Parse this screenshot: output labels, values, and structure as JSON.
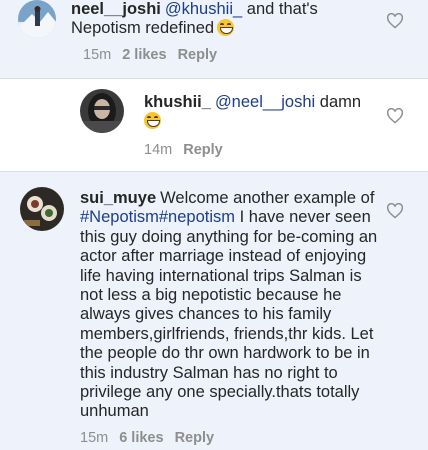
{
  "comments": [
    {
      "username": "neel__joshi",
      "mention": "@khushii_",
      "text": "and that's Nepotism redefined",
      "time": "15m",
      "likes": "2 likes",
      "reply": "Reply"
    },
    {
      "username": "khushii_",
      "mention": "@neel__joshi",
      "text": "damn",
      "time": "14m",
      "reply": "Reply"
    },
    {
      "username": "sui_muye",
      "text_before": "Welcome another example of",
      "tags": "#Nepotism#nepotism",
      "text_after": "I have never seen this guy doing anything for be-coming an actor after marriage instead of enjoying life having international trips Salman is not less a big nepotistic because he always gives chances to his family members,girlfriends, friends,thr kids. Let the people do thr own hardwork to be in this industry Salman has no right to privilege any one specially.thats totally unhuman",
      "time": "15m",
      "likes": "6 likes",
      "reply": "Reply"
    }
  ],
  "icons": {
    "like": "heart-outline-icon",
    "emoji": "grinning-sweat-emoji"
  },
  "colors": {
    "background": "#edf2fb",
    "mention": "#1c3f8c",
    "meta": "#8e8e8e"
  }
}
